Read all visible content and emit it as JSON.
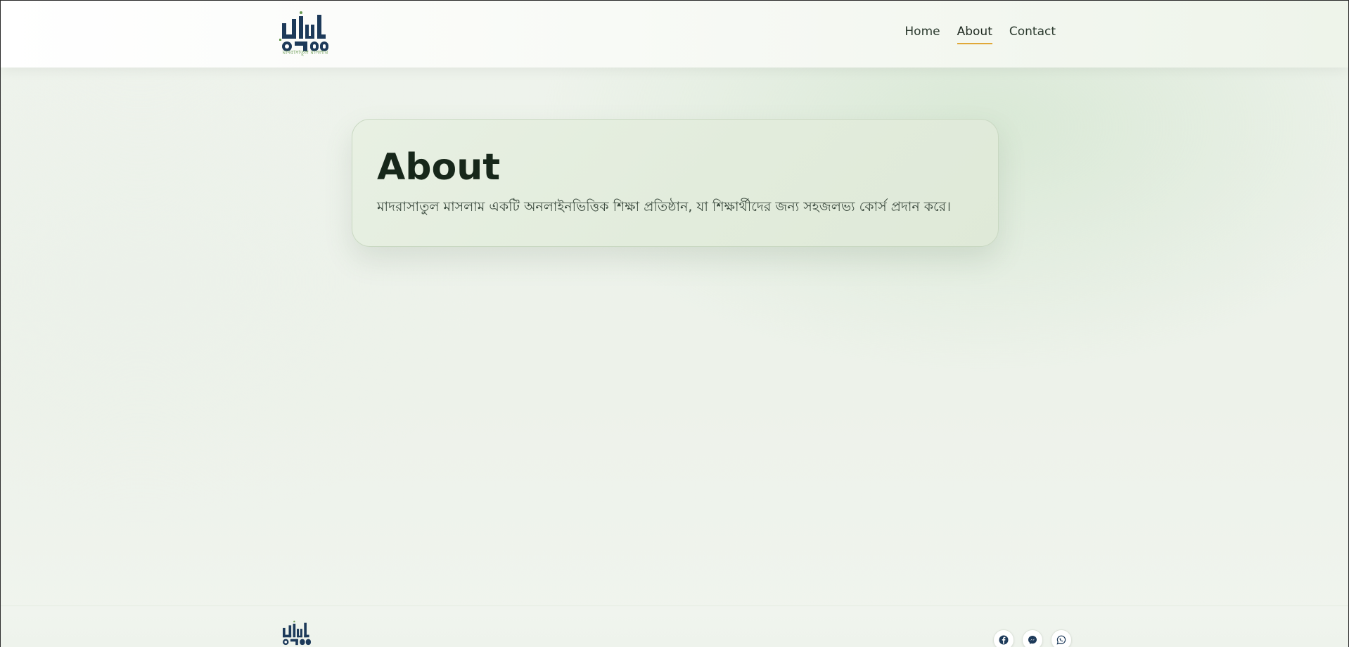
{
  "header": {
    "logo_caption": "মাদরাসাতুল মাসলাম",
    "nav": [
      {
        "label": "Home",
        "active": false
      },
      {
        "label": "About",
        "active": true
      },
      {
        "label": "Contact",
        "active": false
      }
    ]
  },
  "main": {
    "title": "About",
    "description": "মাদরাসাতুল মাসলাম একটি অনলাইনভিত্তিক শিক্ষা প্রতিষ্ঠান, যা শিক্ষার্থীদের জন্য সহজলভ্য কোর্স প্রদান করে।"
  },
  "footer": {
    "social": [
      {
        "icon": "facebook-icon"
      },
      {
        "icon": "messenger-icon"
      },
      {
        "icon": "whatsapp-icon"
      }
    ]
  },
  "colors": {
    "brand_navy": "#1d3a5a",
    "brand_green": "#6a9a52",
    "accent_underline": "#e0a838",
    "heading": "#17271a"
  }
}
